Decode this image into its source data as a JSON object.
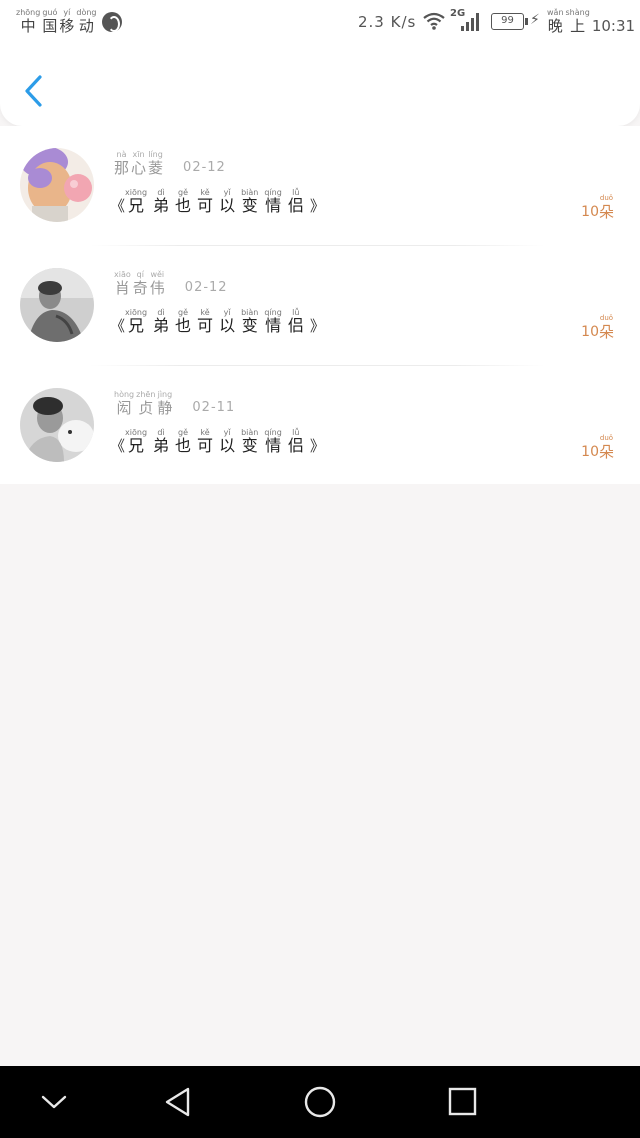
{
  "status_bar": {
    "carrier": [
      {
        "py": "zhōng",
        "hz": "中"
      },
      {
        "py": "guó",
        "hz": "国"
      },
      {
        "py": "yí",
        "hz": "移"
      },
      {
        "py": "dòng",
        "hz": "动"
      }
    ],
    "speed": "2.3 K/s",
    "network_type": "2G",
    "battery": "99",
    "clock_prefix": [
      {
        "py": "wǎn",
        "hz": "晚"
      },
      {
        "py": "shàng",
        "hz": "上"
      }
    ],
    "time": "10:31",
    "icons": [
      "carrier-globe-icon",
      "wifi-icon",
      "signal-icon",
      "battery-icon",
      "charging-bolt-icon"
    ]
  },
  "nav": {
    "back_icon": "chevron-left-icon",
    "accent_color": "#2c9ce8"
  },
  "records": [
    {
      "name": [
        {
          "py": "nà",
          "hz": "那"
        },
        {
          "py": "xīn",
          "hz": "心"
        },
        {
          "py": "líng",
          "hz": "菱"
        }
      ],
      "date": "02-12",
      "title": [
        {
          "py": "xiōng",
          "hz": "兄"
        },
        {
          "py": "dì",
          "hz": "弟"
        },
        {
          "py": "gě",
          "hz": "也"
        },
        {
          "py": "kě",
          "hz": "可"
        },
        {
          "py": "yǐ",
          "hz": "以"
        },
        {
          "py": "biàn",
          "hz": "变"
        },
        {
          "py": "qíng",
          "hz": "情"
        },
        {
          "py": "lǚ",
          "hz": "侣"
        }
      ],
      "count": "10",
      "unit": {
        "py": "duǒ",
        "hz": "朵"
      },
      "avatar": "avatar-cartoon"
    },
    {
      "name": [
        {
          "py": "xiāo",
          "hz": "肖"
        },
        {
          "py": "qí",
          "hz": "奇"
        },
        {
          "py": "wěi",
          "hz": "伟"
        }
      ],
      "date": "02-12",
      "title": [
        {
          "py": "xiōng",
          "hz": "兄"
        },
        {
          "py": "dì",
          "hz": "弟"
        },
        {
          "py": "gě",
          "hz": "也"
        },
        {
          "py": "kě",
          "hz": "可"
        },
        {
          "py": "yǐ",
          "hz": "以"
        },
        {
          "py": "biàn",
          "hz": "变"
        },
        {
          "py": "qíng",
          "hz": "情"
        },
        {
          "py": "lǚ",
          "hz": "侣"
        }
      ],
      "count": "10",
      "unit": {
        "py": "duǒ",
        "hz": "朵"
      },
      "avatar": "avatar-photo"
    },
    {
      "name": [
        {
          "py": "hòng",
          "hz": "闳"
        },
        {
          "py": "zhēn",
          "hz": "贞"
        },
        {
          "py": "jìng",
          "hz": "静"
        }
      ],
      "date": "02-11",
      "title": [
        {
          "py": "xiōng",
          "hz": "兄"
        },
        {
          "py": "dì",
          "hz": "弟"
        },
        {
          "py": "gě",
          "hz": "也"
        },
        {
          "py": "kě",
          "hz": "可"
        },
        {
          "py": "yǐ",
          "hz": "以"
        },
        {
          "py": "biàn",
          "hz": "变"
        },
        {
          "py": "qíng",
          "hz": "情"
        },
        {
          "py": "lǚ",
          "hz": "侣"
        }
      ],
      "count": "10",
      "unit": {
        "py": "duǒ",
        "hz": "朵"
      },
      "avatar": "avatar-photo"
    }
  ],
  "title_quote_open": "《",
  "title_quote_close": "》",
  "navbar": {
    "icons": [
      "chevron-down-icon",
      "back-triangle-icon",
      "home-circle-icon",
      "recents-square-icon"
    ]
  }
}
